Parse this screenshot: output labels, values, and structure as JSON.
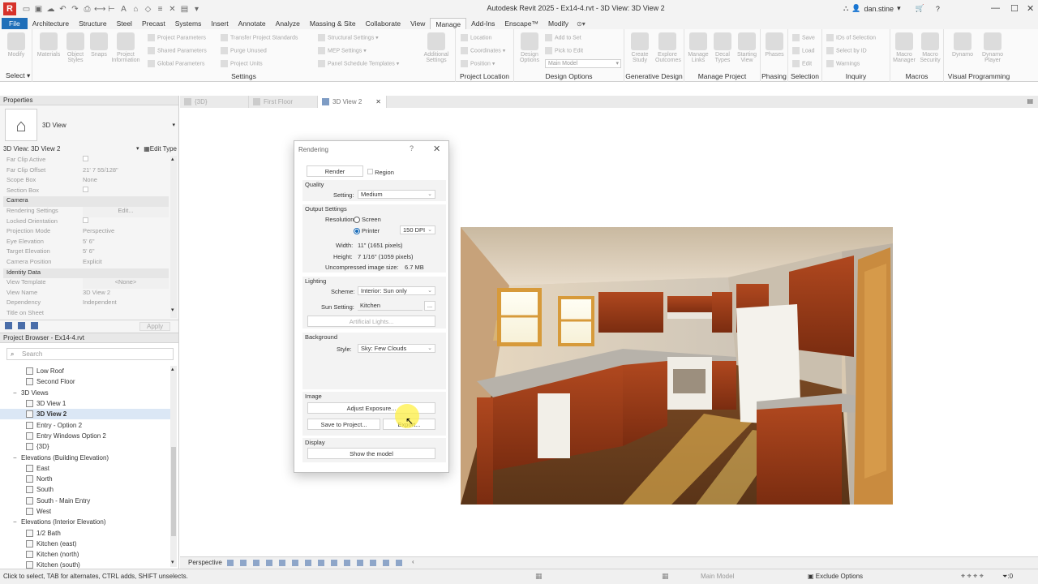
{
  "window": {
    "title": "Autodesk Revit 2025 - Ex14-4.rvt - 3D View: 3D View 2",
    "user": "dan.stine"
  },
  "ribbon": {
    "tabs": [
      "File",
      "Architecture",
      "Structure",
      "Steel",
      "Precast",
      "Systems",
      "Insert",
      "Annotate",
      "Analyze",
      "Massing & Site",
      "Collaborate",
      "View",
      "Manage",
      "Add-Ins",
      "Enscape™",
      "Modify"
    ],
    "active_tab": "Manage",
    "groups": {
      "select": "Select",
      "settings": "Settings",
      "project_location": "Project Location",
      "design_options": "Design Options",
      "generative_design": "Generative Design",
      "manage_project": "Manage Project",
      "phasing": "Phasing",
      "selection": "Selection",
      "inquiry": "Inquiry",
      "macros": "Macros",
      "visual_programming": "Visual Programming"
    },
    "buttons": {
      "modify": "Modify",
      "materials": "Materials",
      "object_styles": "Object Styles",
      "snaps": "Snaps",
      "project_information": "Project Information",
      "project_parameters": "Project Parameters",
      "shared_parameters": "Shared Parameters",
      "global_parameters": "Global Parameters",
      "transfer_standards": "Transfer Project Standards",
      "purge_unused": "Purge Unused",
      "project_units": "Project Units",
      "structural_settings": "Structural Settings",
      "mep_settings": "MEP Settings",
      "panel_schedule_templates": "Panel Schedule Templates",
      "additional_settings": "Additional Settings",
      "location": "Location",
      "coordinates": "Coordinates",
      "position": "Position",
      "design_options": "Design Options",
      "add_to_set": "Add to Set",
      "pick_to_edit": "Pick to Edit",
      "main_model": "Main Model",
      "create_study": "Create Study",
      "explore_outcomes": "Explore Outcomes",
      "manage_links": "Manage Links",
      "decal_types": "Decal Types",
      "starting_view": "Starting View",
      "phases": "Phases",
      "save": "Save",
      "load": "Load",
      "edit": "Edit",
      "ids_of_selection": "IDs of Selection",
      "select_by_id": "Select by ID",
      "warnings": "Warnings",
      "macro_manager": "Macro Manager",
      "macro_security": "Macro Security",
      "dynamo": "Dynamo",
      "dynamo_player": "Dynamo Player"
    }
  },
  "properties": {
    "header": "Properties",
    "type_name": "3D View",
    "instance_label": "3D View: 3D View 2",
    "edit_type": "Edit Type",
    "apply": "Apply",
    "rows": [
      {
        "k": "Far Clip Active",
        "v": "",
        "check": true
      },
      {
        "k": "Far Clip Offset",
        "v": "21'  7 55/128\""
      },
      {
        "k": "Scope Box",
        "v": "None"
      },
      {
        "k": "Section Box",
        "v": "",
        "check": true
      },
      {
        "k": "Camera",
        "section": true
      },
      {
        "k": "Rendering Settings",
        "v": "Edit..."
      },
      {
        "k": "Locked Orientation",
        "v": "",
        "check": true
      },
      {
        "k": "Projection Mode",
        "v": "Perspective"
      },
      {
        "k": "Eye Elevation",
        "v": "5'  6\""
      },
      {
        "k": "Target Elevation",
        "v": "5'  6\""
      },
      {
        "k": "Camera Position",
        "v": "Explicit"
      },
      {
        "k": "Identity Data",
        "section": true
      },
      {
        "k": "View Template",
        "v": "<None>"
      },
      {
        "k": "View Name",
        "v": "3D View 2"
      },
      {
        "k": "Dependency",
        "v": "Independent"
      },
      {
        "k": "Title on Sheet",
        "v": ""
      }
    ]
  },
  "browser": {
    "header": "Project Browser - Ex14-4.rvt",
    "search_placeholder": "Search",
    "items": [
      {
        "label": "Low Roof",
        "indent": 3,
        "icon": true
      },
      {
        "label": "Second Floor",
        "indent": 3,
        "icon": true
      },
      {
        "label": "3D Views",
        "indent": 1,
        "exp": "−"
      },
      {
        "label": "3D View 1",
        "indent": 3,
        "icon": true
      },
      {
        "label": "3D View 2",
        "indent": 3,
        "icon": true,
        "selected": true
      },
      {
        "label": "Entry - Option 2",
        "indent": 3,
        "icon": true
      },
      {
        "label": "Entry Windows Option 2",
        "indent": 3,
        "icon": true
      },
      {
        "label": "{3D}",
        "indent": 3,
        "icon": true
      },
      {
        "label": "Elevations (Building Elevation)",
        "indent": 1,
        "exp": "−"
      },
      {
        "label": "East",
        "indent": 3,
        "icon": true
      },
      {
        "label": "North",
        "indent": 3,
        "icon": true
      },
      {
        "label": "South",
        "indent": 3,
        "icon": true
      },
      {
        "label": "South - Main Entry",
        "indent": 3,
        "icon": true
      },
      {
        "label": "West",
        "indent": 3,
        "icon": true
      },
      {
        "label": "Elevations (Interior Elevation)",
        "indent": 1,
        "exp": "−"
      },
      {
        "label": "1/2 Bath",
        "indent": 3,
        "icon": true
      },
      {
        "label": "Kitchen (east)",
        "indent": 3,
        "icon": true
      },
      {
        "label": "Kitchen (north)",
        "indent": 3,
        "icon": true
      },
      {
        "label": "Kitchen (south)",
        "indent": 3,
        "icon": true
      }
    ]
  },
  "view_tabs": [
    {
      "label": "{3D}",
      "active": false
    },
    {
      "label": "First Floor",
      "active": false
    },
    {
      "label": "3D View 2",
      "active": true
    }
  ],
  "dialog": {
    "title": "Rendering",
    "help": "?",
    "render_button": "Render",
    "region_label": "Region",
    "quality_section": "Quality",
    "setting_label": "Setting:",
    "setting_value": "Medium",
    "output_section": "Output Settings",
    "resolution_label": "Resolution:",
    "screen_label": "Screen",
    "printer_label": "Printer",
    "dpi_value": "150 DPI",
    "width_label": "Width:",
    "width_value": "11\"  (1651 pixels)",
    "height_label": "Height:",
    "height_value": "7 1/16\"  (1059 pixels)",
    "size_label": "Uncompressed image size:",
    "size_value": "6.7 MB",
    "lighting_section": "Lighting",
    "scheme_label": "Scheme:",
    "scheme_value": "Interior: Sun only",
    "sun_label": "Sun Setting:",
    "sun_value": "Kitchen",
    "sun_browse": "...",
    "artificial_lights": "Artificial Lights...",
    "background_section": "Background",
    "style_label": "Style:",
    "style_value": "Sky: Few Clouds",
    "image_section": "Image",
    "adjust_exposure": "Adjust Exposure...",
    "save_to_project": "Save to Project...",
    "export": "Export...",
    "display_section": "Display",
    "show_model": "Show the model"
  },
  "view_control": {
    "projection": "Perspective"
  },
  "status": {
    "message": "Click to select, TAB for alternates, CTRL adds, SHIFT unselects.",
    "model": "Main Model",
    "exclude_options": "Exclude Options",
    "count": ":0"
  },
  "colors": {
    "file_tab": "#1f6fb9",
    "accent": "#1f6fb9"
  }
}
